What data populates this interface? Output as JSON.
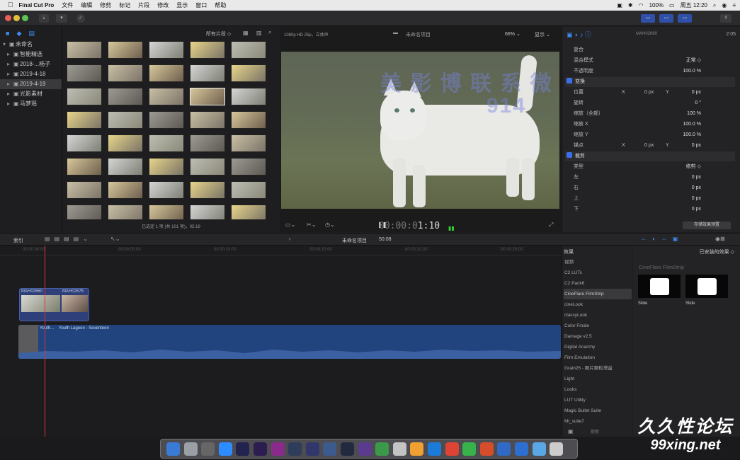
{
  "menubar": {
    "apple_icon": "apple-icon",
    "app_name": "Final Cut Pro",
    "items": [
      "文件",
      "编辑",
      "修剪",
      "标记",
      "片段",
      "修改",
      "显示",
      "窗口",
      "帮助"
    ],
    "status": {
      "battery": "100%",
      "clock": "周五 12:20"
    }
  },
  "toolbar": {
    "btn1": "▾",
    "btn2": "✓"
  },
  "library": {
    "items": [
      {
        "label": "未命名",
        "level": 0,
        "arrow": "▾"
      },
      {
        "label": "智能精选",
        "level": 1,
        "arrow": "▸"
      },
      {
        "label": "2018-...杨子",
        "level": 1,
        "arrow": "▸"
      },
      {
        "label": "2019-4-18",
        "level": 1,
        "arrow": "▸"
      },
      {
        "label": "2019-4-19",
        "level": 1,
        "arrow": "▸",
        "selected": true
      },
      {
        "label": "光影素材",
        "level": 1,
        "arrow": "▸"
      },
      {
        "label": "马梦瑶",
        "level": 1,
        "arrow": "▸"
      }
    ]
  },
  "browser": {
    "filter_label": "所有片段 ◇",
    "footer": "已选定 1 项 (共 101 项)，05:19"
  },
  "viewer": {
    "format": "1080p HD 25p，立体声",
    "project_name": "未命名项目",
    "zoom": "66% ⌄",
    "view_menu": "显示 ⌄",
    "timecode_dim": "00:00:0",
    "timecode_bright": "1:10",
    "watermark_line1": "美 影 博  联 系 微",
    "watermark_line2": "914"
  },
  "inspector": {
    "clip_name": "MAH02660",
    "duration": "2:05",
    "rows": [
      {
        "label": "复合",
        "section": false
      },
      {
        "label": "混合模式",
        "value": "正常 ◇"
      },
      {
        "label": "不透明度",
        "value": "100.0 %"
      },
      {
        "label": "变换",
        "section": true
      },
      {
        "label": "位置",
        "xlab": "X",
        "xval": "0 px",
        "ylab": "Y",
        "value": "0 px"
      },
      {
        "label": "旋转",
        "value": "0 °"
      },
      {
        "label": "缩放（全部）",
        "value": "100 %"
      },
      {
        "label": "缩放 X",
        "value": "100.0 %"
      },
      {
        "label": "缩放 Y",
        "value": "100.0 %"
      },
      {
        "label": "锚点",
        "xlab": "X",
        "xval": "0 px",
        "ylab": "Y",
        "value": "0 px"
      },
      {
        "label": "裁剪",
        "section": true
      },
      {
        "label": "类型",
        "value": "修剪 ◇"
      },
      {
        "label": "左",
        "value": "0 px"
      },
      {
        "label": "右",
        "value": "0 px"
      },
      {
        "label": "上",
        "value": "0 px"
      },
      {
        "label": "下",
        "value": "0 px"
      }
    ],
    "save_button": "存储效果预置"
  },
  "timeline_bar": {
    "index": "索引",
    "project": "未命名项目",
    "duration": "50:08",
    "ruler": [
      "00:00:00:00",
      "00:00:05:00",
      "00:00:10:00",
      "00:00:15:00",
      "00:00:20:00",
      "00:00:25:00",
      "00:00:30:00"
    ]
  },
  "timeline": {
    "clip_a_left": "MAH02660",
    "clip_a_right": "MAH02675",
    "audio_label1": "Youth...",
    "audio_label2": "Youth Lagoon - Seventeen"
  },
  "effects": {
    "header": "效果",
    "installed": "已安装的效果 ◇",
    "list": [
      "视频",
      "C2 LUTs",
      "C2 Pack6",
      "CineFlare FilmStrip",
      "cineLook",
      "classyLook",
      "Color Finale",
      "Damage v2.5",
      "Digital Anarchy",
      "Film Emulation",
      "Grain25 - 颗片颗粒增益",
      "Light",
      "Looks",
      "LUT Utility",
      "Magic Bullet Suite",
      "Ml_suite7"
    ],
    "selected_index": 3,
    "preview_title": "CineFlare FilmStrip",
    "preview_items": [
      "Slide",
      "Slide"
    ],
    "search_placeholder": "搜索"
  },
  "watermark_brand": {
    "line1": "久久性论坛",
    "line2": "99xing.net"
  },
  "colors": {
    "accent": "#3b6ee8",
    "playhead": "#dd3333",
    "audio": "#22447e",
    "clip": "#2e3f7a"
  }
}
